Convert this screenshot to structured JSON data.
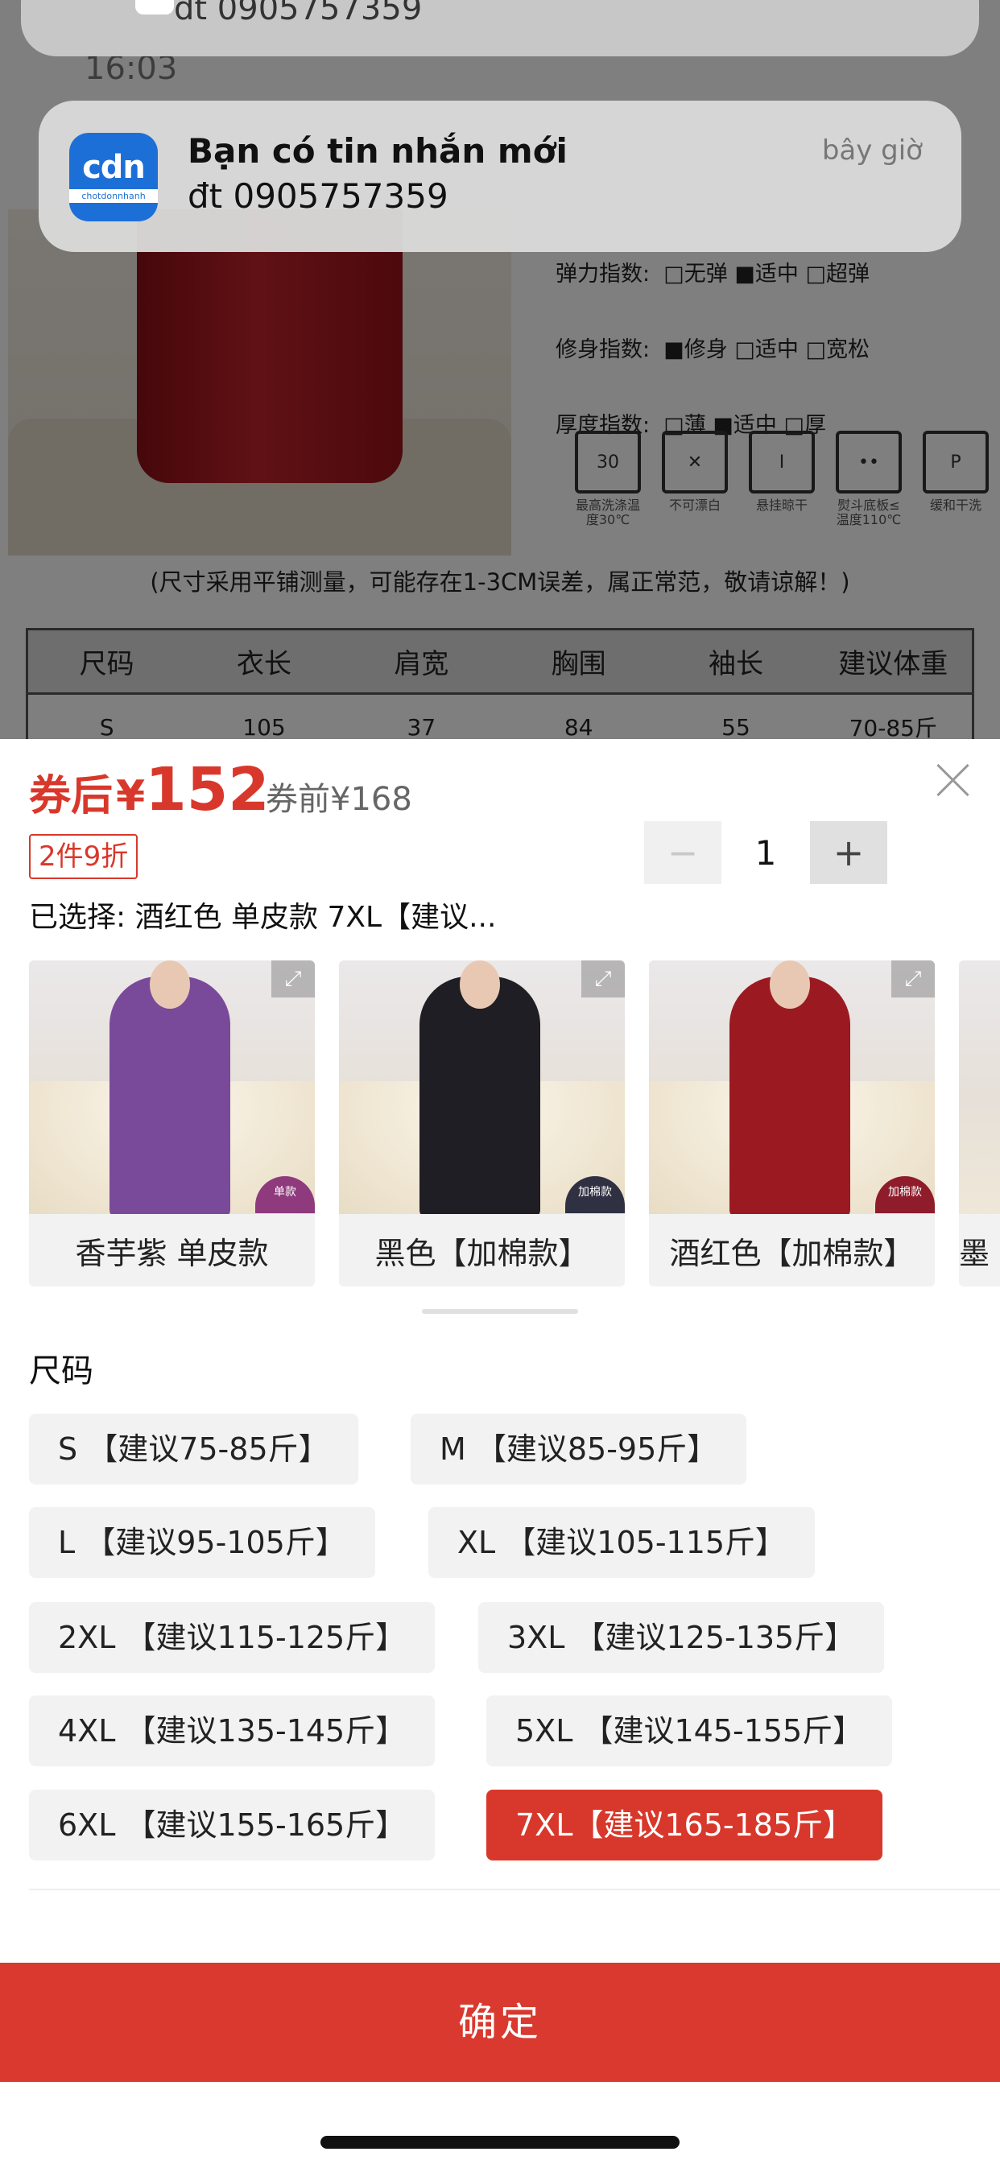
{
  "background": {
    "spec_rows": [
      {
        "label": "弹力指数:",
        "options": "□无弹 ■适中 □超弹"
      },
      {
        "label": "修身指数:",
        "options": "■修身 □适中 □宽松"
      },
      {
        "label": "厚度指数:",
        "options": "□薄 ■适中 □厚"
      }
    ],
    "care_icons": [
      {
        "symbol": "30",
        "caption": "最高洗涤温度30℃"
      },
      {
        "symbol": "✕",
        "caption": "不可漂白"
      },
      {
        "symbol": "Ⅰ",
        "caption": "悬挂晾干"
      },
      {
        "symbol": "••",
        "caption": "熨斗底板≤温度110℃"
      },
      {
        "symbol": "P",
        "caption": "缓和干洗"
      }
    ],
    "note": "(尺寸采用平铺测量，可能存在1-3CM误差，属正常范，敬请谅解！)",
    "table_headers": [
      "尺码",
      "衣长",
      "肩宽",
      "胸围",
      "袖长",
      "建议体重"
    ],
    "table_row": [
      "S",
      "105",
      "37",
      "84",
      "55",
      "70-85斤"
    ]
  },
  "notification_ghost": {
    "text": "đt 0905757359",
    "time": "16:03"
  },
  "notification": {
    "app_logo": "cdn",
    "app_sub": "chotdonnhanh",
    "title": "Bạn có tin nhắn mới",
    "body": "đt 0905757359",
    "time": "bây giờ"
  },
  "sheet": {
    "price_after_label": "券后",
    "currency": "¥",
    "price_after": "152",
    "price_before": "券前¥168",
    "promo": "2件9折",
    "quantity": "1",
    "minus": "−",
    "plus": "+",
    "selected": "已选择: 酒红色 单皮款 7XL【建议...",
    "variants": [
      {
        "label": "香芋紫 单皮款",
        "tag": "单款",
        "color": "#7a4a9a",
        "tag_color": "#8e3a7d"
      },
      {
        "label": "黑色【加棉款】",
        "tag": "加棉款",
        "color": "#1e1e24",
        "tag_color": "#2f3042"
      },
      {
        "label": "酒红色【加棉款】",
        "tag": "加棉款",
        "color": "#9b1a22",
        "tag_color": "#8e1c2a"
      },
      {
        "label": "墨",
        "tag": "",
        "color": "#d9d3c6",
        "tag_color": "#d9d3c6"
      }
    ],
    "size_title": "尺码",
    "sizes": [
      "S 【建议75-85斤】",
      "M 【建议85-95斤】",
      "L 【建议95-105斤】",
      "XL 【建议105-115斤】",
      "2XL 【建议115-125斤】",
      "3XL 【建议125-135斤】",
      "4XL 【建议135-145斤】",
      "5XL 【建议145-155斤】",
      "6XL 【建议155-165斤】",
      "7XL【建议165-185斤】"
    ],
    "selected_size_index": 9,
    "confirm": "确定"
  },
  "colors": {
    "accent": "#d8382b",
    "confirm_bg": "#d9392e"
  }
}
